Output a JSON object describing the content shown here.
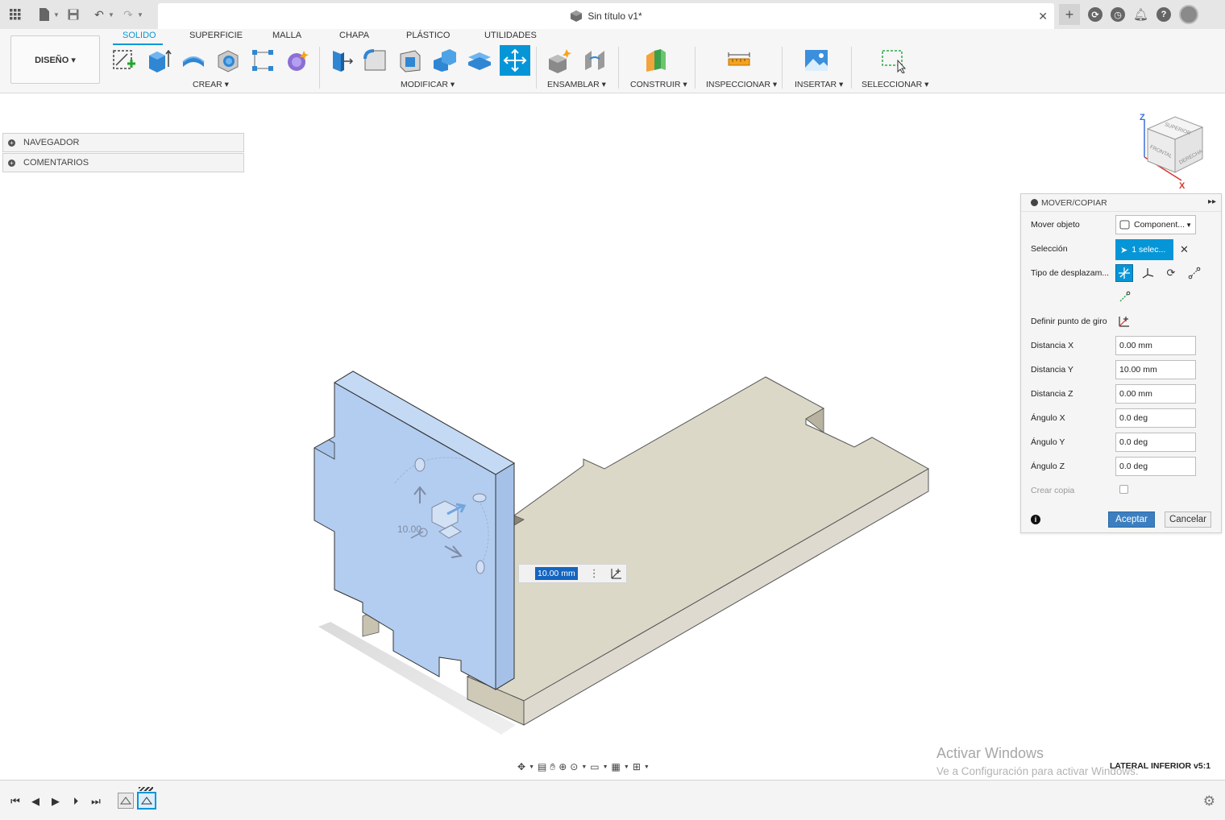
{
  "title_bar": {
    "doc_title": "Sin título v1*",
    "close_symbol": "✕"
  },
  "ribbon": {
    "workspace": "DISEÑO ▾",
    "tabs": [
      "SOLIDO",
      "SUPERFICIE",
      "MALLA",
      "CHAPA",
      "PLÁSTICO",
      "UTILIDADES"
    ],
    "groups": {
      "crear": "CREAR ▾",
      "modificar": "MODIFICAR ▾",
      "ensamblar": "ENSAMBLAR ▾",
      "construir": "CONSTRUIR ▾",
      "inspeccionar": "INSPECCIONAR ▾",
      "insertar": "INSERTAR ▾",
      "seleccionar": "SELECCIONAR ▾"
    }
  },
  "browser": {
    "navegador": "NAVEGADOR",
    "comentarios": "COMENTARIOS"
  },
  "viewcube": {
    "top": "SUPERIOR",
    "front": "FRONTAL",
    "right": "DERECHA",
    "axis_z": "Z",
    "axis_x": "X"
  },
  "viewport": {
    "inline_value": "10.00 mm",
    "ghost_value": "10.00"
  },
  "dialog": {
    "title": "MOVER/COPIAR",
    "rows": {
      "mover_objeto": "Mover objeto",
      "seleccion": "Selección",
      "tipo": "Tipo de desplazam...",
      "punto_giro": "Definir punto de giro",
      "dist_x": "Distancia X",
      "dist_y": "Distancia Y",
      "dist_z": "Distancia Z",
      "ang_x": "Ángulo X",
      "ang_y": "Ángulo Y",
      "ang_z": "Ángulo Z",
      "crear_copia": "Crear copia"
    },
    "values": {
      "mover_objeto": "Component...",
      "seleccion": "1 selec...",
      "dist_x": "0.00 mm",
      "dist_y": "10.00 mm",
      "dist_z": "0.00 mm",
      "ang_x": "0.0 deg",
      "ang_y": "0.0 deg",
      "ang_z": "0.0 deg"
    },
    "ok": "Aceptar",
    "cancel": "Cancelar"
  },
  "status": {
    "watermark_title": "Activar Windows",
    "watermark_sub": "Ve a Configuración para activar Windows.",
    "view_label": "LATERAL INFERIOR v5:1"
  },
  "colors": {
    "accent": "#0696d7",
    "plate": "#dcd8c8",
    "plate_side": "#cfcab7",
    "selected_body": "#b3cdf0",
    "ok_button": "#3c7fc0"
  }
}
